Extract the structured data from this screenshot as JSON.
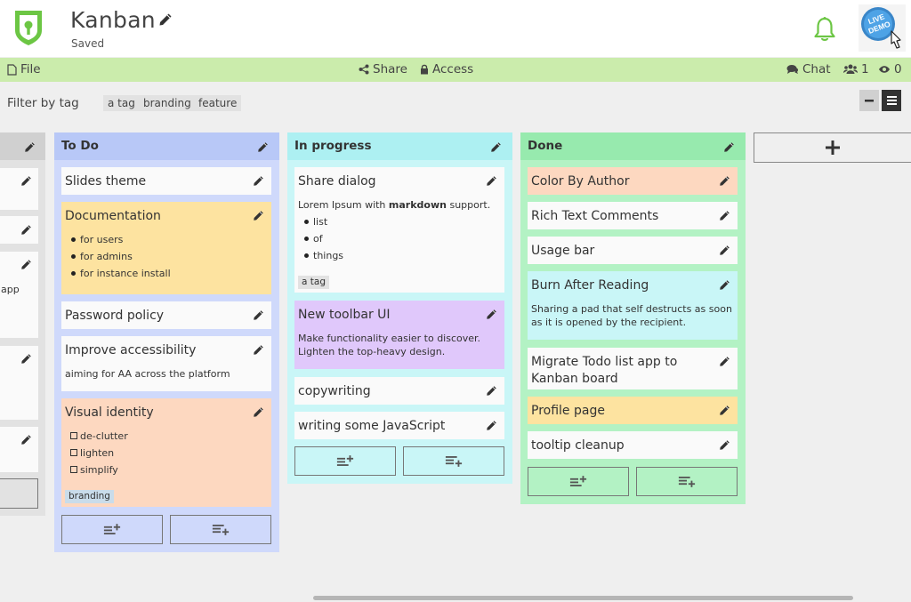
{
  "header": {
    "title": "Kanban",
    "status": "Saved",
    "demo_badge": "LIVE DEMO"
  },
  "toolbar": {
    "file": "File",
    "share": "Share",
    "access": "Access",
    "chat": "Chat",
    "users_count": "1",
    "viewers_count": "0"
  },
  "filter": {
    "label": "Filter by tag",
    "tags": [
      "a tag",
      "branding",
      "feature"
    ]
  },
  "columns": {
    "partial": {
      "card_fragment": "app"
    },
    "todo": {
      "title": "To Do",
      "color": "#cfd9fb",
      "cards": {
        "slides": {
          "title": "Slides theme"
        },
        "docs": {
          "title": "Documentation",
          "items": [
            "for users",
            "for admins",
            "for instance install"
          ],
          "color": "#fde3a0"
        },
        "password": {
          "title": "Password policy"
        },
        "a11y": {
          "title": "Improve accessibility",
          "body": "aiming for AA across the platform"
        },
        "visual": {
          "title": "Visual identity",
          "items": [
            "de-clutter",
            "lighten",
            "simplify"
          ],
          "tag": "branding",
          "color": "#fdd8c0"
        }
      }
    },
    "inprogress": {
      "title": "In progress",
      "color": "#c9f6f7",
      "cards": {
        "share": {
          "title": "Share dialog",
          "body_pre": "Lorem Ipsum with ",
          "body_bold": "markdown",
          "body_post": " support.",
          "items": [
            "list",
            "of",
            "things"
          ],
          "tag": "a tag"
        },
        "toolbar": {
          "title": "New toolbar UI",
          "body": "Make functionality easier to discover. Lighten the top-heavy design.",
          "color": "#e0c8fb"
        },
        "copy": {
          "title": "copywriting"
        },
        "js": {
          "title": "writing some JavaScript"
        }
      }
    },
    "done": {
      "title": "Done",
      "color": "#b3f2c4",
      "cards": {
        "color": {
          "title": "Color By Author",
          "color": "#fdd8c0"
        },
        "rich": {
          "title": "Rich Text Comments"
        },
        "usage": {
          "title": "Usage bar"
        },
        "burn": {
          "title": "Burn After Reading",
          "body": "Sharing a pad that self destructs as soon as it is opened by the recipient.",
          "color": "#c9f6f7"
        },
        "migrate": {
          "title": "Migrate Todo list app to Kanban board"
        },
        "profile": {
          "title": "Profile page",
          "color": "#fde3a0"
        },
        "tooltip": {
          "title": "tooltip cleanup"
        }
      }
    }
  },
  "icons": {
    "logo": "shield-keyhole-icon",
    "bell": "bell-icon",
    "edit": "pencil-icon",
    "add_card_top": "add-top-icon",
    "add_card_bottom": "add-bottom-icon",
    "add_column": "plus-icon"
  },
  "colors": {
    "toolbar_bg": "#cbecac",
    "brand_green": "#6cc644",
    "todo_bg": "#cfd9fb",
    "progress_bg": "#c9f6f7",
    "done_bg": "#b3f2c4"
  }
}
